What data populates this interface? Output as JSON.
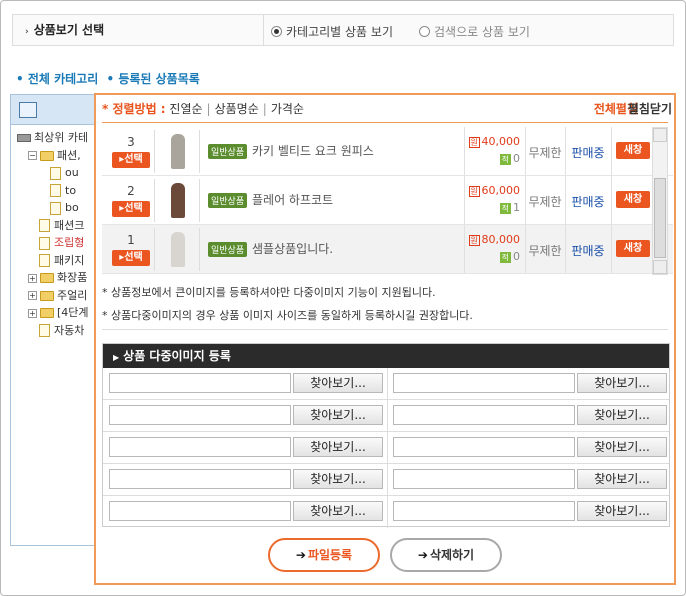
{
  "view_select": {
    "title": "상품보기 선택",
    "options": [
      {
        "label": "카테고리별 상품 보기",
        "selected": true
      },
      {
        "label": "검색으로 상품 보기",
        "selected": false
      }
    ]
  },
  "category_links": [
    "• 전체 카테고리",
    "• 등록된 상품목록"
  ],
  "tree": {
    "items": [
      {
        "text": "최상위 카테",
        "type": "drive",
        "indent": 0
      },
      {
        "text": "패션,",
        "type": "folder",
        "toggle": "−",
        "indent": 1
      },
      {
        "text": "ou",
        "type": "doc",
        "indent": 3
      },
      {
        "text": "to",
        "type": "doc",
        "indent": 3
      },
      {
        "text": "bo",
        "type": "doc",
        "indent": 3
      },
      {
        "text": "패션크",
        "type": "doc",
        "indent": 2
      },
      {
        "text": "조립형",
        "type": "doc",
        "indent": 2,
        "highlight": true
      },
      {
        "text": "패키지",
        "type": "doc",
        "indent": 2
      },
      {
        "text": "화장품",
        "type": "folder",
        "toggle": "+",
        "indent": 1
      },
      {
        "text": "주얼리",
        "type": "folder",
        "toggle": "+",
        "indent": 1
      },
      {
        "text": "[4단계",
        "type": "folder",
        "toggle": "+",
        "indent": 1
      },
      {
        "text": "자동차",
        "type": "doc",
        "indent": 2
      }
    ]
  },
  "sort": {
    "label": "* 정렬방법 :",
    "options": [
      "진열순",
      "상품명순",
      "가격순"
    ],
    "expand_all": "전체펼침",
    "collapse_all": "펼침닫기"
  },
  "products": [
    {
      "num": "3",
      "select": "선택",
      "tag": "일반상품",
      "name": "카키 벨티드 요크 원피스",
      "price": "40,000",
      "points": "0",
      "stock": "무제한",
      "status": "판매중",
      "newwin": "새창",
      "thumb_color": "#a9a59c"
    },
    {
      "num": "2",
      "select": "선택",
      "tag": "일반상품",
      "name": "플레어 하프코트",
      "price": "60,000",
      "points": "1",
      "stock": "무제한",
      "status": "판매중",
      "newwin": "새창",
      "thumb_color": "#6b4a3a"
    },
    {
      "num": "1",
      "select": "선택",
      "tag": "일반상품",
      "name": "샘플상품입니다.",
      "price": "80,000",
      "points": "0",
      "stock": "무제한",
      "status": "판매중",
      "newwin": "새창",
      "thumb_color": "#d8d4cf"
    }
  ],
  "price_icon": "원",
  "points_icon": "적",
  "notes": [
    "* 상품정보에서 큰이미지를 등록하셔야만 다중이미지 기능이 지원됩니다.",
    "* 상품다중이미지의 경우 상품 이미지 사이즈를 동일하게 등록하시길 권장합니다."
  ],
  "register": {
    "title": "상품 다중이미지 등록",
    "browse_label": "찾아보기...",
    "rows": 5
  },
  "actions": {
    "upload": "파일등록",
    "delete": "삭제하기"
  },
  "colors": {
    "accent": "#ea5520",
    "link": "#1a7ab7",
    "status": "#1a4fa8"
  }
}
